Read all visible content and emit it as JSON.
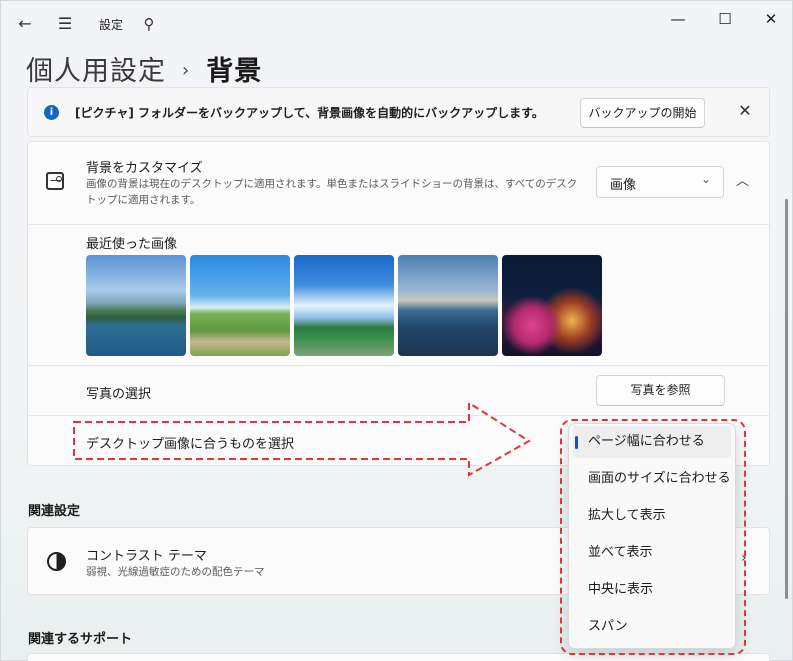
{
  "window": {
    "app_title": "設定",
    "controls": {
      "minimize": "—",
      "maximize": "☐",
      "close": "✕"
    }
  },
  "titlebar": {
    "back_icon": "←",
    "menu_icon": "☰",
    "search_icon": "⚲"
  },
  "breadcrumb": {
    "parent": "個人用設定",
    "separator": "›",
    "current": "背景"
  },
  "info_bar": {
    "icon": "i",
    "text": "[ピクチャ] フォルダーをバックアップして、背景画像を自動的にバックアップします。",
    "button": "バックアップの開始",
    "close": "✕"
  },
  "personalize": {
    "title": "背景をカスタマイズ",
    "description": "画像の背景は現在のデスクトップに適用されます。単色またはスライドショーの背景は、すべてのデスクトップに適用されます。",
    "select_value": "画像",
    "select_chevron": "⌄",
    "collapse_icon": "︿"
  },
  "recent": {
    "label": "最近使った画像",
    "images": [
      "island-lake",
      "green-field-road",
      "blue-sky-trees",
      "lighthouse-coast",
      "lanterns-night"
    ]
  },
  "photo_select": {
    "label": "写真の選択",
    "button": "写真を参照"
  },
  "fit_select": {
    "label": "デスクトップ画像に合うものを選択"
  },
  "related_settings": {
    "heading": "関連設定",
    "contrast": {
      "title": "コントラスト テーマ",
      "description": "弱視、光線過敏症のための配色テーマ",
      "chevron": "›"
    }
  },
  "related_support": {
    "heading": "関連するサポート"
  },
  "fit_dropdown": {
    "selected_index": 0,
    "options": [
      "ページ幅に合わせる",
      "画面のサイズに合わせる",
      "拡大して表示",
      "並べて表示",
      "中央に表示",
      "スパン"
    ]
  },
  "colors": {
    "accent": "#0b5cad",
    "annotation": "#e0363a",
    "info_icon": "#1366c2"
  }
}
